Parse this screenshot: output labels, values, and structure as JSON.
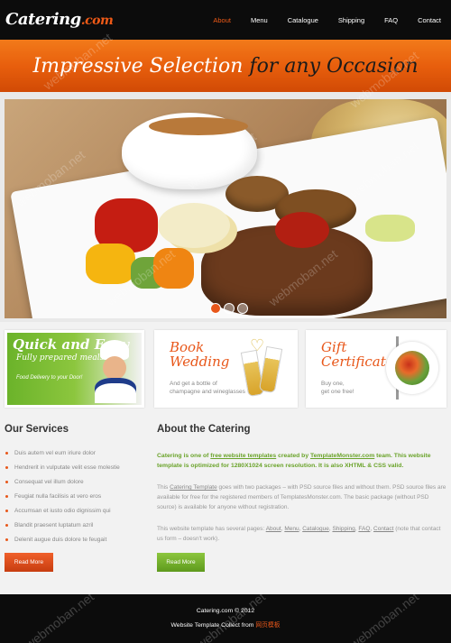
{
  "brand": {
    "name": "Catering",
    "domain": ".com"
  },
  "nav": [
    {
      "label": "About",
      "active": true
    },
    {
      "label": "Menu",
      "active": false
    },
    {
      "label": "Catalogue",
      "active": false
    },
    {
      "label": "Shipping",
      "active": false
    },
    {
      "label": "FAQ",
      "active": false
    },
    {
      "label": "Contact",
      "active": false
    }
  ],
  "banner": {
    "part1": "Impressive Selection ",
    "part2": "for any Occasion"
  },
  "slider": {
    "total_dots": 3,
    "active_index": 0
  },
  "promos": {
    "quick": {
      "title": "Quick and Easy",
      "subtitle": "Fully prepared meals",
      "small": "Food Delivery to your Door!"
    },
    "wedding": {
      "title1": "Book",
      "title2": "Wedding",
      "line1": "And get a bottle of",
      "line2": "champagne and wineglasses"
    },
    "gift": {
      "title1": "Gift",
      "title2": "Certificates",
      "line1": "Buy one,",
      "line2": "get one free!"
    }
  },
  "services": {
    "heading": "Our Services",
    "items": [
      "Duis autem vel eum iriure dolor",
      "Hendrerit in vulputate velit esse molestie",
      "Consequat vel illum dolore",
      "Feugiat nulla facilisis at vero eros",
      "Accumsan et iusto odio dignissim qui",
      "Blandit praesent luptatum azril",
      "Delenit augue duis dolore te feugait"
    ],
    "button": "Read More"
  },
  "about": {
    "heading": "About the Catering",
    "lead_a": "Catering is one of ",
    "lead_link1": "free website templates",
    "lead_b": " created by ",
    "lead_link2": "TemplateMonster.com",
    "lead_c": " team. This website template is optimized for 1280X1024 screen resolution. It is also XHTML & CSS valid.",
    "p1_a": "This ",
    "p1_link": "Catering Template",
    "p1_b": " goes with two packages – with PSD source files and without them. PSD source files are available for free for the registered members of TemplatesMonster.com. The basic package (without PSD source) is available for anyone without registration.",
    "p2_a": "This website template has several pages: ",
    "p2_links": [
      "About",
      "Menu",
      "Catalogue",
      "Shipping",
      "FAQ",
      "Contact"
    ],
    "p2_b": " (note that contact us form – doesn't work).",
    "button": "Read More"
  },
  "footer": {
    "line1": "Catering.com © 2012",
    "line2_prefix": "Website Template Collect from ",
    "line2_link": "网页模板"
  },
  "watermark": "webmoban.net",
  "colors": {
    "accent": "#e8571a",
    "green": "#6aa32a",
    "dark": "#0c0c0c"
  }
}
